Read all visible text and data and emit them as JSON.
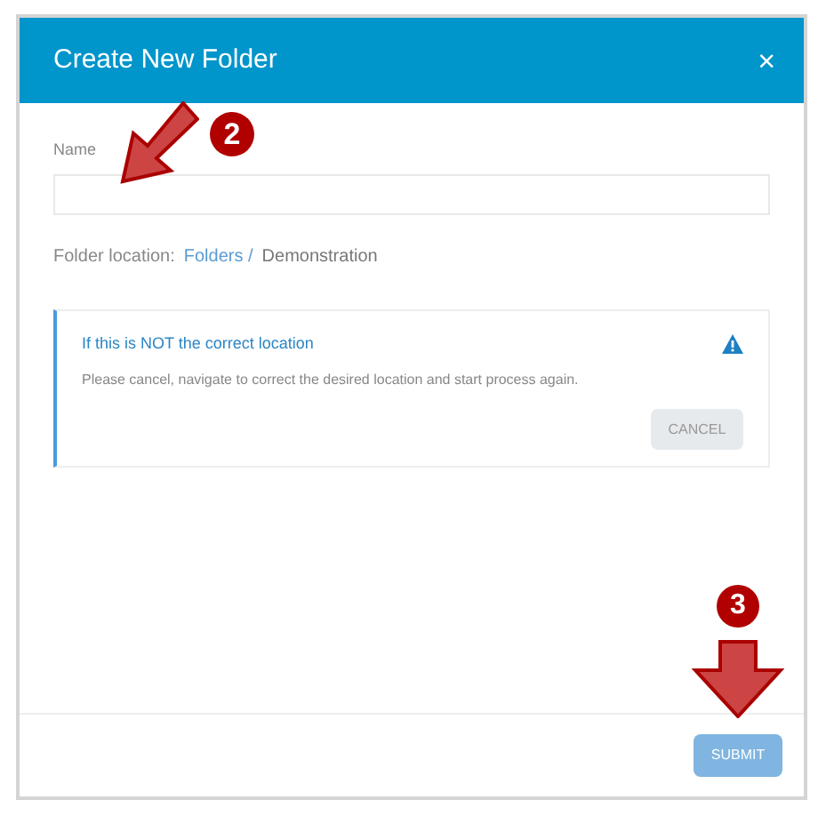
{
  "dialog": {
    "title": "Create New Folder",
    "close": "×"
  },
  "name_field": {
    "label": "Name"
  },
  "location": {
    "label": "Folder location:",
    "link": "Folders /",
    "current": "Demonstration"
  },
  "alert": {
    "title": "If this is NOT the correct location",
    "message": "Please cancel, navigate to correct the desired location and start process again.",
    "button": "CANCEL"
  },
  "submit": {
    "label": "SUBMIT",
    "disabled": true
  },
  "annotations": [
    {
      "label": "2"
    },
    {
      "label": "3"
    }
  ]
}
